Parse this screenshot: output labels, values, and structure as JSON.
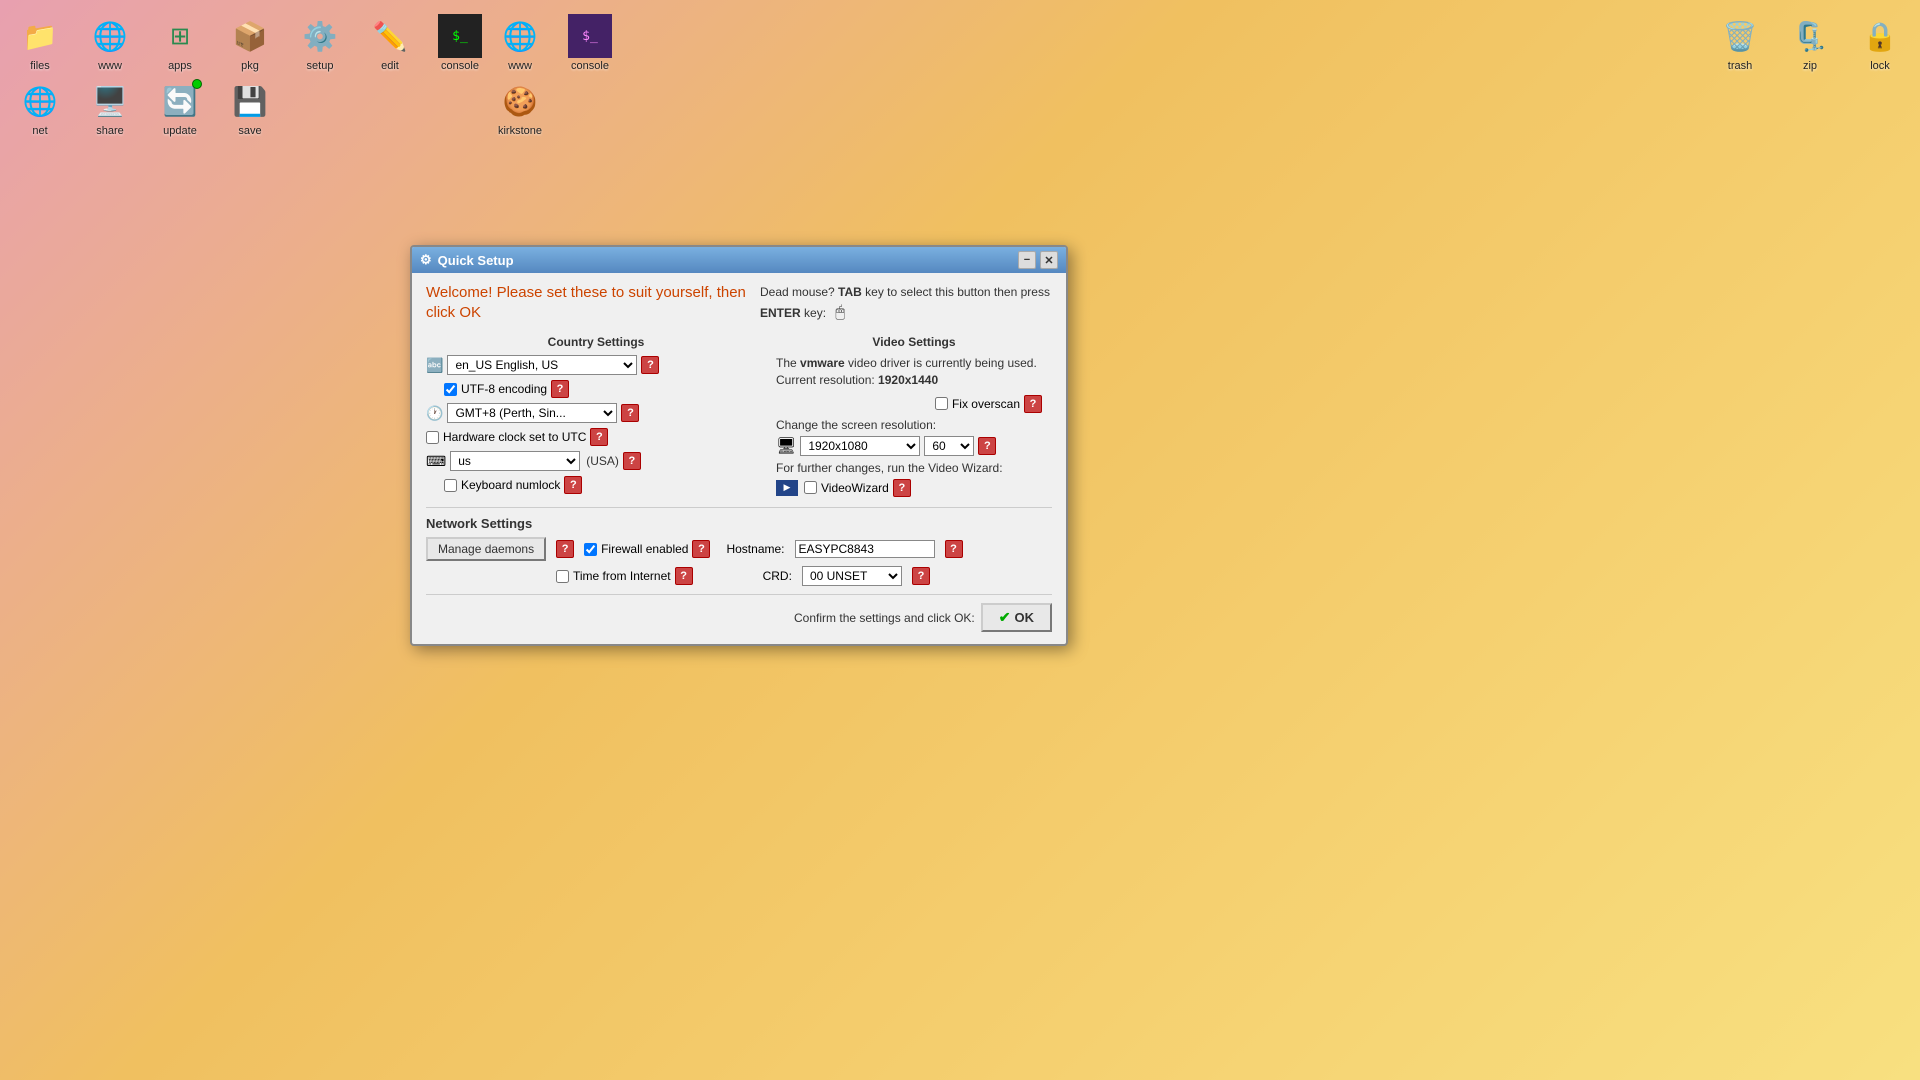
{
  "desktop": {
    "icons_left": [
      {
        "id": "files",
        "label": "files",
        "icon": "📁"
      },
      {
        "id": "www",
        "label": "www",
        "icon": "🌐"
      },
      {
        "id": "apps",
        "label": "apps",
        "icon": "⊞"
      },
      {
        "id": "pkg",
        "label": "pkg",
        "icon": "📦"
      },
      {
        "id": "setup",
        "label": "setup",
        "icon": "⚙"
      },
      {
        "id": "edit",
        "label": "edit",
        "icon": "✏"
      },
      {
        "id": "console",
        "label": "console",
        "icon": "⬛"
      }
    ],
    "icons_left2": [
      {
        "id": "net",
        "label": "net",
        "icon": "🌐"
      },
      {
        "id": "share",
        "label": "share",
        "icon": "🖥"
      },
      {
        "id": "update",
        "label": "update",
        "icon": "🔄"
      },
      {
        "id": "save",
        "label": "save",
        "icon": "💾"
      }
    ],
    "icons_center": [
      {
        "id": "www2",
        "label": "www",
        "icon": "🌐"
      },
      {
        "id": "console2",
        "label": "console",
        "icon": "⬛"
      }
    ],
    "icons_center2": [
      {
        "id": "kirkstone",
        "label": "kirkstone",
        "icon": "🍪"
      }
    ],
    "icons_right": [
      {
        "id": "trash",
        "label": "trash",
        "icon": "🗑"
      },
      {
        "id": "zip",
        "label": "zip",
        "icon": "📂"
      },
      {
        "id": "lock",
        "label": "lock",
        "icon": "🔒"
      }
    ]
  },
  "dialog": {
    "title": "Quick Setup",
    "welcome_text": "Welcome! Please set these to suit yourself, then click OK",
    "hint_text": "Dead mouse? TAB key to select this button then press ENTER key:",
    "hint_bold1": "TAB",
    "hint_bold2": "ENTER",
    "country_section": "Country Settings",
    "locale_value": "en_US   English, US",
    "utf8_label": "UTF-8 encoding",
    "timezone_value": "GMT+8    (Perth, Sin...",
    "hardware_clock_label": "Hardware clock set to UTC",
    "keyboard_value": "us",
    "keyboard_country": "(USA)",
    "keyboard_numlock_label": "Keyboard numlock",
    "video_section": "Video Settings",
    "video_driver_text": "The vmware video driver is currently being used. Current resolution: 1920x1440",
    "vmware_bold": "vmware",
    "resolution_bold": "1920x1440",
    "fix_overscan_label": "Fix overscan",
    "change_resolution_label": "Change the screen resolution:",
    "resolution_value": "1920x1080",
    "refresh_value": "60",
    "further_changes_text": "For further changes, run the Video Wizard:",
    "videowizard_label": "VideoWizard",
    "network_section": "Network Settings",
    "manage_daemons_label": "Manage daemons",
    "firewall_enabled_label": "Firewall enabled",
    "time_internet_label": "Time from Internet",
    "hostname_label": "Hostname:",
    "hostname_value": "EASYPC8843",
    "crd_label": "CRD:",
    "crd_value": "00 UNSET",
    "confirm_text": "Confirm the settings and click OK:",
    "ok_label": "OK",
    "minimize_label": "−",
    "close_label": "✕"
  }
}
